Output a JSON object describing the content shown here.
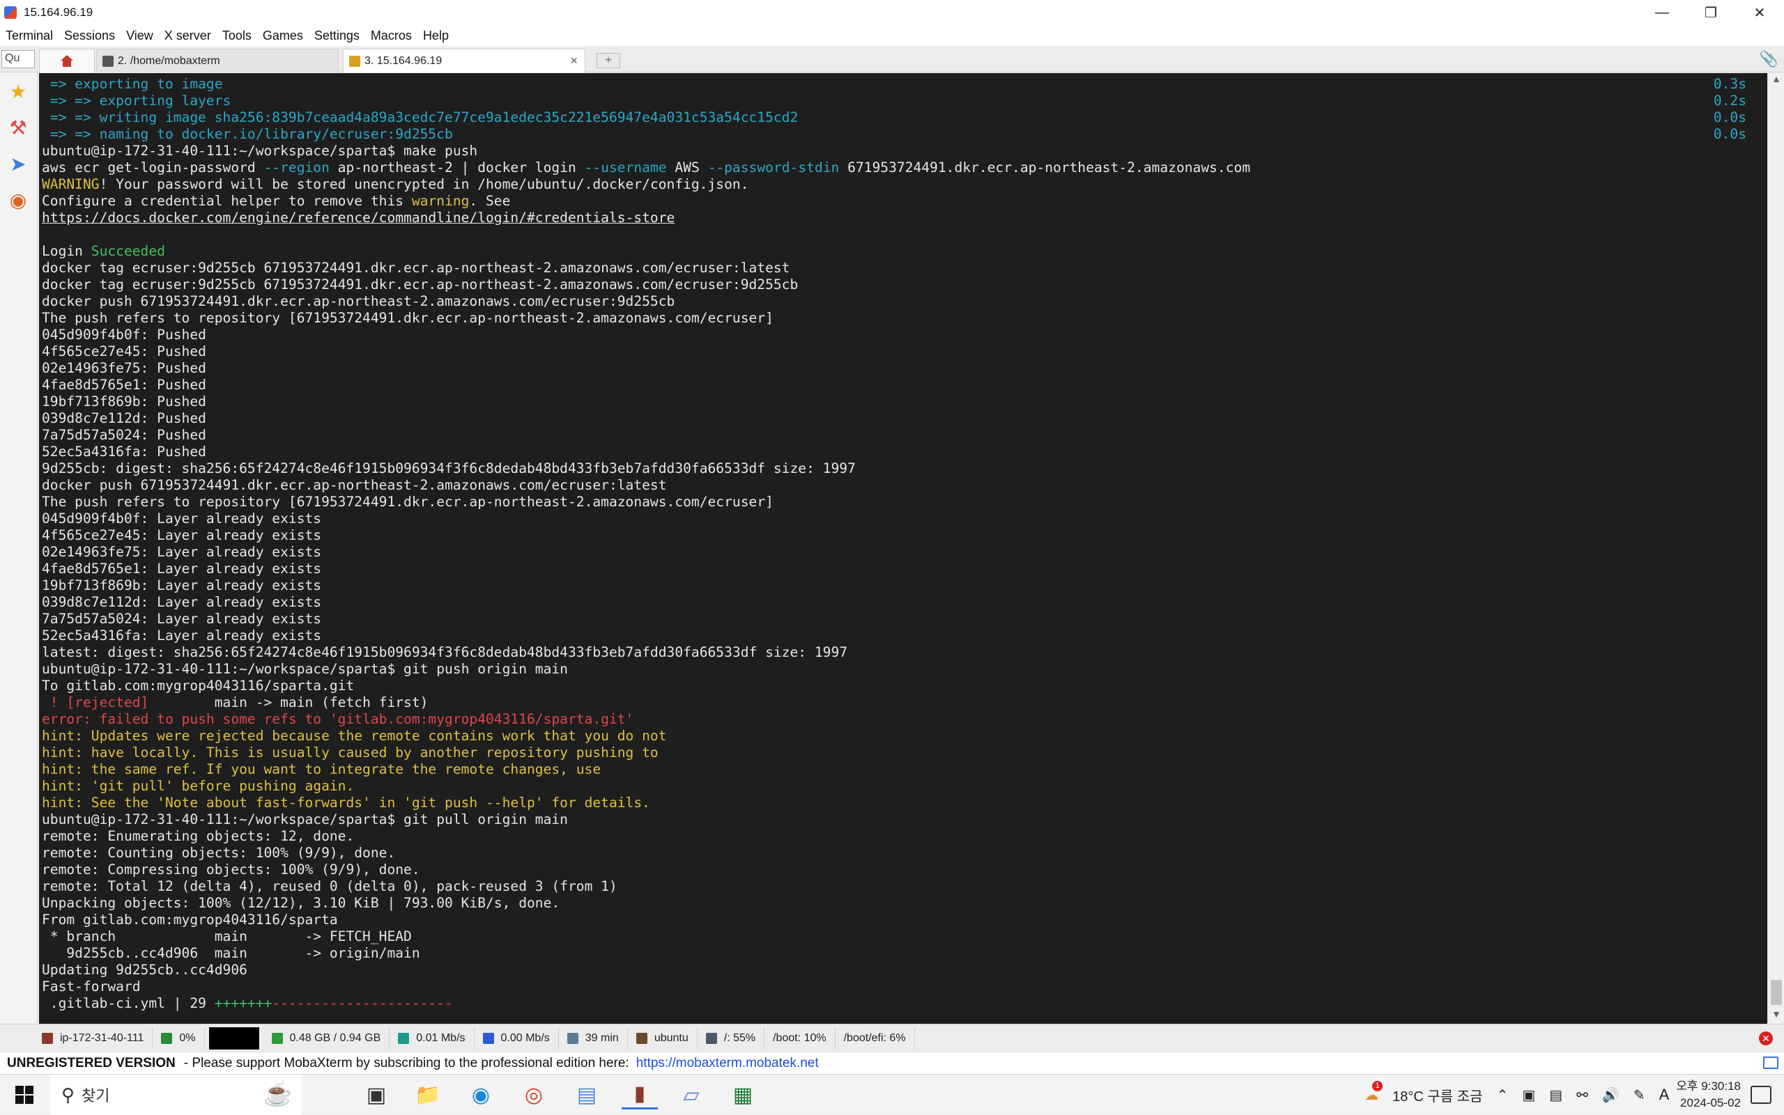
{
  "window": {
    "title": "15.164.96.19"
  },
  "menu": [
    "Terminal",
    "Sessions",
    "View",
    "X server",
    "Tools",
    "Games",
    "Settings",
    "Macros",
    "Help"
  ],
  "tabs": {
    "quick_connect": "Qu",
    "tab1_label": "2. /home/mobaxterm",
    "tab2_label": "3. 15.164.96.19"
  },
  "terminal": {
    "lines": [
      {
        "c": "cyan",
        "t": " => exporting to image"
      },
      {
        "c": "cyan",
        "t": " => => exporting layers"
      },
      {
        "c": "cyan",
        "t": " => => writing image sha256:839b7ceaad4a89a3cedc7e77ce9a1edec35c221e56947e4a031c53a54cc15cd2"
      },
      {
        "c": "cyan",
        "t": " => => naming to docker.io/library/ecruser:9d255cb"
      },
      {
        "c": "",
        "t": "ubuntu@ip-172-31-40-111:~/workspace/sparta$ make push"
      },
      {
        "c": "",
        "t": "aws ecr get-login-password --region ap-northeast-2 | docker login --username AWS --password-stdin 671953724491.dkr.ecr.ap-northeast-2.amazonaws.com"
      },
      {
        "c": "",
        "t": "WARNING! Your password will be stored unencrypted in /home/ubuntu/.docker/config.json."
      },
      {
        "c": "",
        "t": "Configure a credential helper to remove this warning. See"
      },
      {
        "c": "link",
        "t": "https://docs.docker.com/engine/reference/commandline/login/#credentials-store"
      },
      {
        "c": "",
        "t": ""
      },
      {
        "c": "",
        "t": "Login Succeeded"
      },
      {
        "c": "",
        "t": "docker tag ecruser:9d255cb 671953724491.dkr.ecr.ap-northeast-2.amazonaws.com/ecruser:latest"
      },
      {
        "c": "",
        "t": "docker tag ecruser:9d255cb 671953724491.dkr.ecr.ap-northeast-2.amazonaws.com/ecruser:9d255cb"
      },
      {
        "c": "",
        "t": "docker push 671953724491.dkr.ecr.ap-northeast-2.amazonaws.com/ecruser:9d255cb"
      },
      {
        "c": "",
        "t": "The push refers to repository [671953724491.dkr.ecr.ap-northeast-2.amazonaws.com/ecruser]"
      },
      {
        "c": "",
        "t": "045d909f4b0f: Pushed"
      },
      {
        "c": "",
        "t": "4f565ce27e45: Pushed"
      },
      {
        "c": "",
        "t": "02e14963fe75: Pushed"
      },
      {
        "c": "",
        "t": "4fae8d5765e1: Pushed"
      },
      {
        "c": "",
        "t": "19bf713f869b: Pushed"
      },
      {
        "c": "",
        "t": "039d8c7e112d: Pushed"
      },
      {
        "c": "",
        "t": "7a75d57a5024: Pushed"
      },
      {
        "c": "",
        "t": "52ec5a4316fa: Pushed"
      },
      {
        "c": "",
        "t": "9d255cb: digest: sha256:65f24274c8e46f1915b096934f3f6c8dedab48bd433fb3eb7afdd30fa66533df size: 1997"
      },
      {
        "c": "",
        "t": "docker push 671953724491.dkr.ecr.ap-northeast-2.amazonaws.com/ecruser:latest"
      },
      {
        "c": "",
        "t": "The push refers to repository [671953724491.dkr.ecr.ap-northeast-2.amazonaws.com/ecruser]"
      },
      {
        "c": "",
        "t": "045d909f4b0f: Layer already exists"
      },
      {
        "c": "",
        "t": "4f565ce27e45: Layer already exists"
      },
      {
        "c": "",
        "t": "02e14963fe75: Layer already exists"
      },
      {
        "c": "",
        "t": "4fae8d5765e1: Layer already exists"
      },
      {
        "c": "",
        "t": "19bf713f869b: Layer already exists"
      },
      {
        "c": "",
        "t": "039d8c7e112d: Layer already exists"
      },
      {
        "c": "",
        "t": "7a75d57a5024: Layer already exists"
      },
      {
        "c": "",
        "t": "52ec5a4316fa: Layer already exists"
      },
      {
        "c": "",
        "t": "latest: digest: sha256:65f24274c8e46f1915b096934f3f6c8dedab48bd433fb3eb7afdd30fa66533df size: 1997"
      },
      {
        "c": "",
        "t": "ubuntu@ip-172-31-40-111:~/workspace/sparta$ git push origin main"
      },
      {
        "c": "",
        "t": "To gitlab.com:mygrop4043116/sparta.git"
      },
      {
        "c": "rejected",
        "t": " ! [rejected]        main -> main (fetch first)"
      },
      {
        "c": "red",
        "t": "error: failed to push some refs to 'gitlab.com:mygrop4043116/sparta.git'"
      },
      {
        "c": "yellow",
        "t": "hint: Updates were rejected because the remote contains work that you do not"
      },
      {
        "c": "yellow",
        "t": "hint: have locally. This is usually caused by another repository pushing to"
      },
      {
        "c": "yellow",
        "t": "hint: the same ref. If you want to integrate the remote changes, use"
      },
      {
        "c": "yellow",
        "t": "hint: 'git pull' before pushing again."
      },
      {
        "c": "yellow",
        "t": "hint: See the 'Note about fast-forwards' in 'git push --help' for details."
      },
      {
        "c": "",
        "t": "ubuntu@ip-172-31-40-111:~/workspace/sparta$ git pull origin main"
      },
      {
        "c": "",
        "t": "remote: Enumerating objects: 12, done."
      },
      {
        "c": "",
        "t": "remote: Counting objects: 100% (9/9), done."
      },
      {
        "c": "",
        "t": "remote: Compressing objects: 100% (9/9), done."
      },
      {
        "c": "",
        "t": "remote: Total 12 (delta 4), reused 0 (delta 0), pack-reused 3 (from 1)"
      },
      {
        "c": "",
        "t": "Unpacking objects: 100% (12/12), 3.10 KiB | 793.00 KiB/s, done."
      },
      {
        "c": "",
        "t": "From gitlab.com:mygrop4043116/sparta"
      },
      {
        "c": "",
        "t": " * branch            main       -> FETCH_HEAD"
      },
      {
        "c": "",
        "t": "   9d255cb..cc4d906  main       -> origin/main"
      },
      {
        "c": "",
        "t": "Updating 9d255cb..cc4d906"
      },
      {
        "c": "",
        "t": "Fast-forward"
      },
      {
        "c": "diffstat",
        "t": " .gitlab-ci.yml | 29 "
      }
    ],
    "diffstat_plus": "+++++++",
    "diffstat_minus": "----------------------",
    "times": [
      "0.3s",
      "0.2s",
      "0.0s",
      "0.0s"
    ]
  },
  "statusbar": {
    "host": "ip-172-31-40-111",
    "cpu": "0%",
    "memory": "0.48 GB / 0.94 GB",
    "upload": "0.01 Mb/s",
    "download": "0.00 Mb/s",
    "uptime": "39 min",
    "user": "ubuntu",
    "disk_root": "/: 55%",
    "disk_boot": "/boot: 10%",
    "disk_efi": "/boot/efi: 6%"
  },
  "banner": {
    "unregistered": "UNREGISTERED VERSION",
    "message": "-  Please support MobaXterm by subscribing to the professional edition here:",
    "link": "https://mobaxterm.mobatek.net"
  },
  "taskbar": {
    "search": "찾기",
    "weather": "18°C 구름 조금",
    "weather_badge": "1",
    "ime": "A",
    "time": "오후 9:30:18",
    "date": "2024-05-02"
  },
  "colors": {
    "terminal_bg": "#1e1e1e",
    "cyan": "#2aa8c8",
    "green": "#40c060",
    "yellow": "#e0c040",
    "red": "#e04848"
  }
}
